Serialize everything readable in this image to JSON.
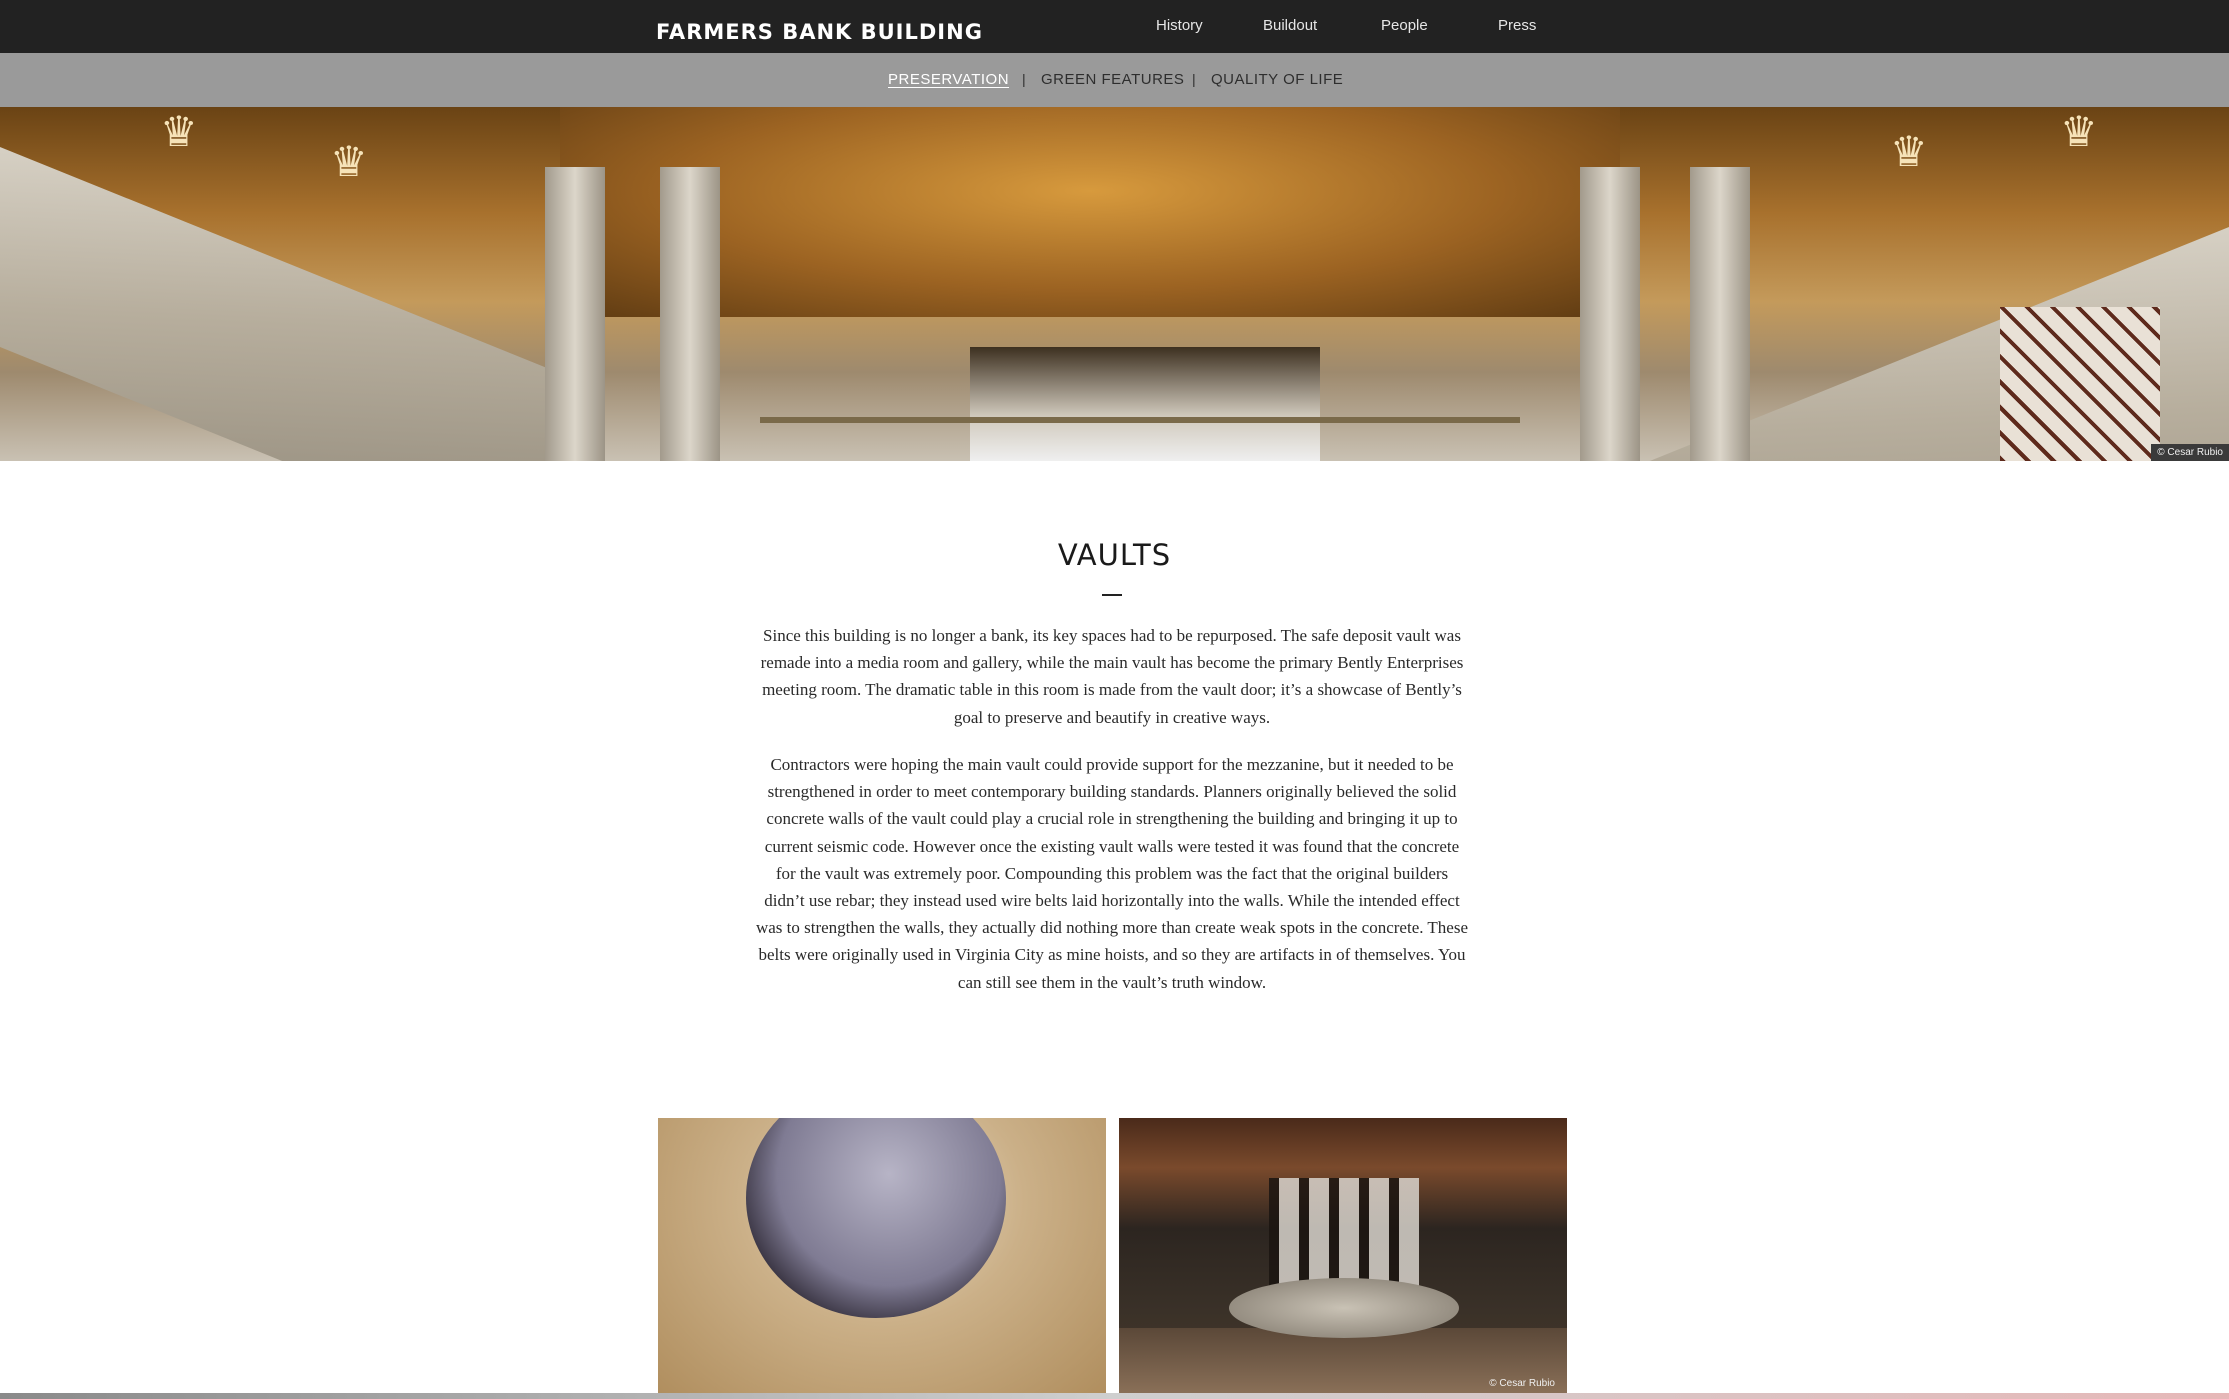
{
  "nav": {
    "brand": "FARMERS BANK BUILDING",
    "links": [
      "History",
      "Buildout",
      "People",
      "Press"
    ]
  },
  "subnav": {
    "items": [
      "PRESERVATION",
      "GREEN FEATURES",
      "QUALITY OF LIFE"
    ],
    "separator": "|",
    "active": "PRESERVATION"
  },
  "hero": {
    "credit": "© Cesar Rubio"
  },
  "section": {
    "title": "VAULTS",
    "paragraphs": [
      "Since this building is no longer a bank, its key spaces had to be repurposed. The safe deposit vault was remade into a media room and gallery, while the main vault has become the primary Bently Enterprises meeting room. The dramatic table in this room is made from the vault door; it’s a showcase of Bently’s goal to preserve and beautify in creative ways.",
      "Contractors were hoping the main vault could provide support for the mezzanine, but it needed to be strengthened in order to meet contemporary building standards. Planners originally believed the solid concrete walls of the vault could play a crucial role in strengthening the building and bringing it up to current seismic code. However once the existing vault walls were tested it was found that the concrete for the vault was extremely poor. Compounding this problem was the fact that the original builders didn’t use rebar; they instead used wire belts laid horizontally into the walls. While the intended effect was to strengthen the walls, they actually did nothing more than create weak spots in the concrete. These belts were originally used in Virginia City as mine hoists, and so they are artifacts in of themselves. You can still see them in the vault’s truth window."
    ]
  },
  "gallery": {
    "credit": "© Cesar Rubio"
  },
  "colors": {
    "topnav_bg": "#222222",
    "subnav_bg": "#9a9a9a",
    "text": "#2a2a2a"
  }
}
